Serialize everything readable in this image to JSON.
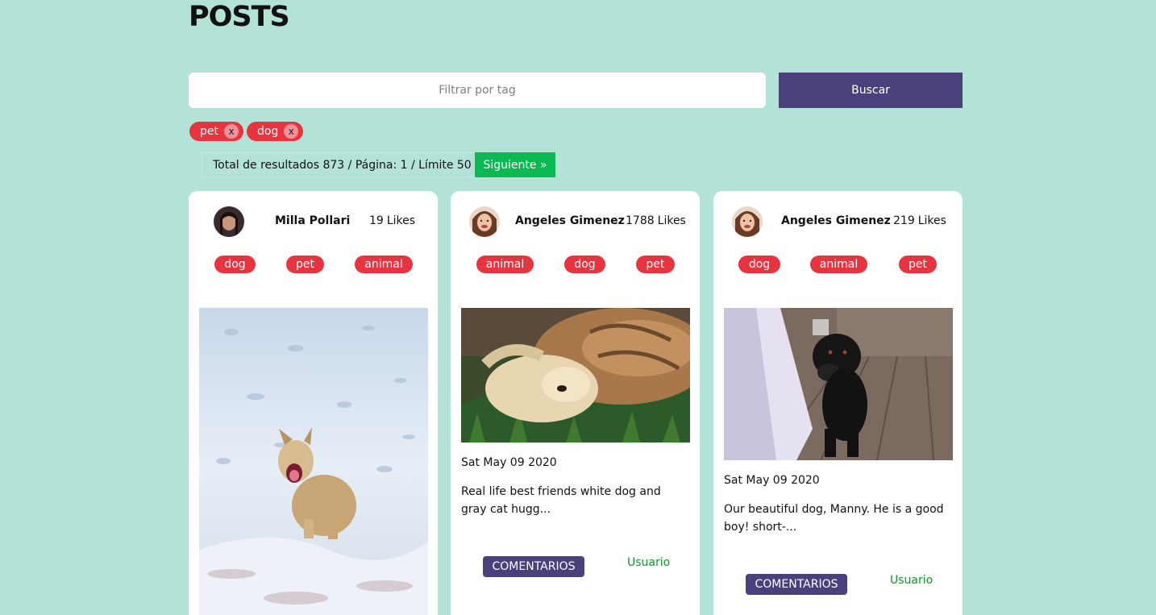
{
  "header": {
    "title": "POSTS"
  },
  "search": {
    "placeholder": "Filtrar por tag",
    "button_label": "Buscar"
  },
  "active_filters": [
    {
      "label": "pet",
      "remove_label": "x"
    },
    {
      "label": "dog",
      "remove_label": "x"
    }
  ],
  "pagination": {
    "summary": "Total de resultados 873 / Página: 1 / Límite 50",
    "next_label": "Siguiente »"
  },
  "posts": [
    {
      "owner": "Milla Pollari",
      "likes": "19",
      "likes_unit": "Likes",
      "tags": [
        "dog",
        "pet",
        "animal"
      ],
      "image": "dog-in-snow-photo",
      "date": "",
      "text": "",
      "comments_label": "",
      "user_label": ""
    },
    {
      "owner": "Angeles Gimenez",
      "likes": "1788",
      "likes_unit": "Likes",
      "tags": [
        "animal",
        "dog",
        "pet"
      ],
      "image": "dog-and-cat-hugging-photo",
      "date": "Sat May 09 2020",
      "text": "Real life best friends white dog and gray cat hugg...",
      "comments_label": "COMENTARIOS",
      "user_label": "Usuario"
    },
    {
      "owner": "Angeles Gimenez",
      "likes": "219",
      "likes_unit": "Likes",
      "tags": [
        "dog",
        "animal",
        "pet"
      ],
      "image": "black-labrador-photo",
      "date": "Sat May 09 2020",
      "text": "Our beautiful dog, Manny. He is a good boy! short-...",
      "comments_label": "COMENTARIOS",
      "user_label": "Usuario"
    }
  ],
  "colors": {
    "background": "#b3e2d6",
    "primary": "#4a417c",
    "tag": "#e8343f",
    "next": "#0ab952",
    "link": "#0a9a25"
  }
}
